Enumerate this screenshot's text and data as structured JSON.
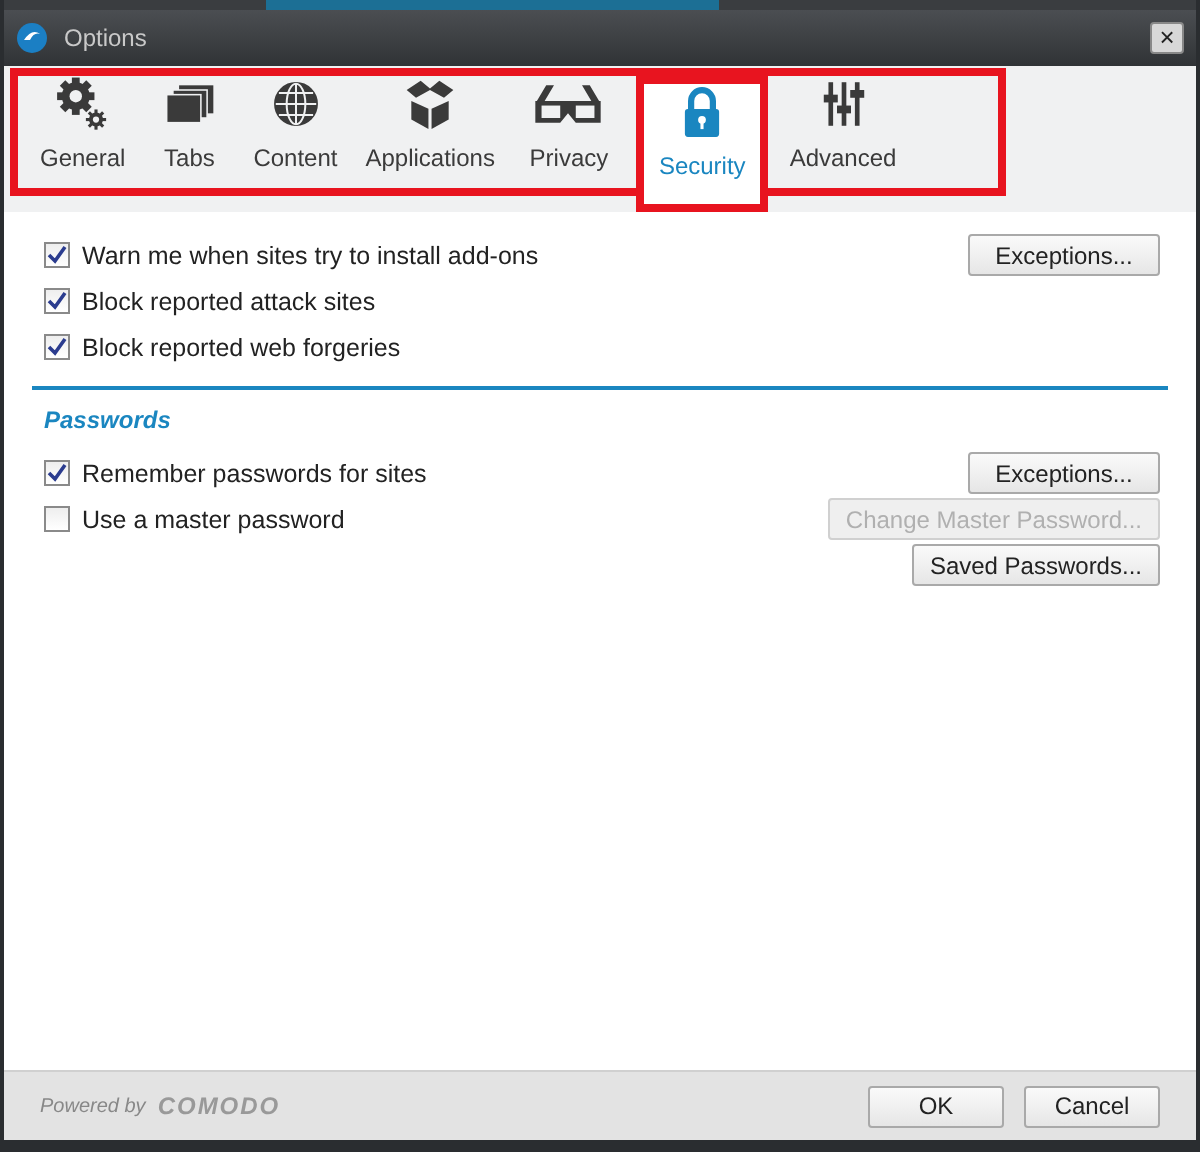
{
  "window": {
    "title": "Options",
    "close": "×"
  },
  "tabs": [
    {
      "label": "General",
      "kind": "gear",
      "selected": false
    },
    {
      "label": "Tabs",
      "kind": "tabs",
      "selected": false
    },
    {
      "label": "Content",
      "kind": "globe",
      "selected": false
    },
    {
      "label": "Applications",
      "kind": "box",
      "selected": false
    },
    {
      "label": "Privacy",
      "kind": "glasses",
      "selected": false
    },
    {
      "label": "Security",
      "kind": "lock",
      "selected": true
    },
    {
      "label": "Advanced",
      "kind": "sliders",
      "selected": false
    }
  ],
  "general": [
    {
      "label": "Warn me when sites try to install add-ons",
      "checked": true,
      "button": {
        "label": "Exceptions...",
        "disabled": false
      }
    },
    {
      "label": "Block reported attack sites",
      "checked": true
    },
    {
      "label": "Block reported web forgeries",
      "checked": true
    }
  ],
  "passwords": {
    "heading": "Passwords",
    "rows": [
      {
        "label": "Remember passwords for sites",
        "checked": true,
        "button": {
          "label": "Exceptions...",
          "disabled": false
        }
      },
      {
        "label": "Use a master password",
        "checked": false,
        "button": {
          "label": "Change Master Password...",
          "disabled": true
        }
      }
    ],
    "extra_button": {
      "label": "Saved Passwords...",
      "disabled": false
    }
  },
  "footer": {
    "powered_by": "Powered by",
    "brand": "COMODO",
    "buttons": [
      "OK",
      "Cancel"
    ]
  }
}
